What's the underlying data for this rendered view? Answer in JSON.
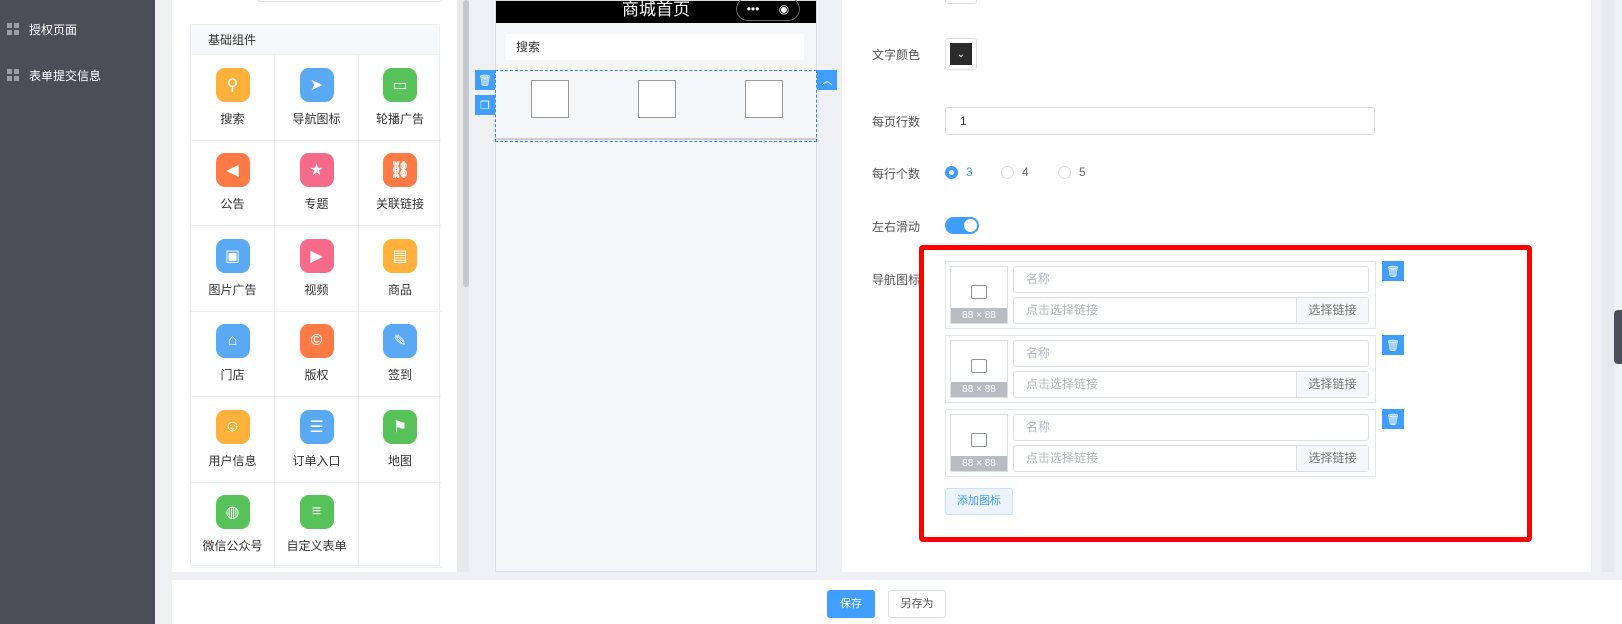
{
  "sidebar": {
    "items": [
      {
        "label": "授权页面"
      },
      {
        "label": "表单提交信息"
      }
    ]
  },
  "components": {
    "section_title": "基础组件",
    "items": [
      {
        "label": "搜索",
        "icon": "search-icon",
        "color": "#ffb13b"
      },
      {
        "label": "导航图标",
        "icon": "navigation-icon",
        "color": "#5aa9f5"
      },
      {
        "label": "轮播广告",
        "icon": "carousel-icon",
        "color": "#58c25a"
      },
      {
        "label": "公告",
        "icon": "announcement-icon",
        "color": "#ff7a45"
      },
      {
        "label": "专题",
        "icon": "topic-icon",
        "color": "#f76b8a"
      },
      {
        "label": "关联链接",
        "icon": "link-icon",
        "color": "#ff7a45"
      },
      {
        "label": "图片广告",
        "icon": "image-icon",
        "color": "#5aa9f5"
      },
      {
        "label": "视频",
        "icon": "video-icon",
        "color": "#f76b8a"
      },
      {
        "label": "商品",
        "icon": "product-icon",
        "color": "#ffb13b"
      },
      {
        "label": "门店",
        "icon": "store-icon",
        "color": "#5aa9f5"
      },
      {
        "label": "版权",
        "icon": "copyright-icon",
        "color": "#ff7a45"
      },
      {
        "label": "签到",
        "icon": "checkin-icon",
        "color": "#5aa9f5"
      },
      {
        "label": "用户信息",
        "icon": "user-info-icon",
        "color": "#ffb13b"
      },
      {
        "label": "订单入口",
        "icon": "order-icon",
        "color": "#5aa9f5"
      },
      {
        "label": "地图",
        "icon": "map-icon",
        "color": "#58c25a"
      },
      {
        "label": "微信公众号",
        "icon": "wechat-icon",
        "color": "#58c25a"
      },
      {
        "label": "自定义表单",
        "icon": "form-icon",
        "color": "#58c25a"
      }
    ]
  },
  "preview": {
    "title": "商城首页",
    "capsule_dots": "•••",
    "capsule_target": "◉",
    "search_text": "搜索"
  },
  "props": {
    "text_color_label": "文字颜色",
    "rows_per_page_label": "每页行数",
    "rows_per_page_value": "1",
    "per_row_label": "每行个数",
    "per_row_options": [
      "3",
      "4",
      "5"
    ],
    "per_row_selected": "3",
    "scroll_label": "左右滑动",
    "scroll_enabled": true,
    "nav_icon_label": "导航图标",
    "nav_items": [
      {
        "size": "88 × 88",
        "name_placeholder": "名称",
        "link_placeholder": "点击选择链接",
        "link_button": "选择链接"
      },
      {
        "size": "88 × 88",
        "name_placeholder": "名称",
        "link_placeholder": "点击选择链接",
        "link_button": "选择链接"
      },
      {
        "size": "88 × 88",
        "name_placeholder": "名称",
        "link_placeholder": "点击选择链接",
        "link_button": "选择链接"
      }
    ],
    "add_button": "添加图标"
  },
  "footer": {
    "save": "保存",
    "save_as": "另存为"
  },
  "colors": {
    "accent": "#409eff",
    "sidebar_bg": "#4a4e57",
    "highlight": "#ff0000"
  }
}
